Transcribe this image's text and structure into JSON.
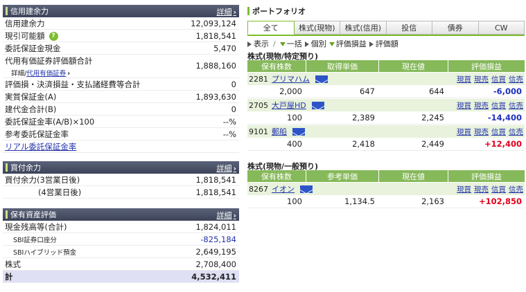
{
  "left": {
    "credit": {
      "title": "信用建余力",
      "detail": "詳細",
      "rows": [
        {
          "label": "信用建余力",
          "value": "12,093,124"
        },
        {
          "label": "現引可能額",
          "value": "1,818,541"
        },
        {
          "label": "委託保証金現金",
          "value": "5,470"
        },
        {
          "label": "代用有価証券評価額合計",
          "sub_label": "詳細/",
          "sub_link": "代用有価証券",
          "value": "1,888,160"
        },
        {
          "label": "評価損・決済損益・支払諸経費等合計",
          "value": "0"
        },
        {
          "label": "実質保証金(A)",
          "value": "1,893,630"
        },
        {
          "label": "建代金合計(B)",
          "value": "0"
        },
        {
          "label": "委託保証金率(A/B)×100",
          "value": "--%"
        },
        {
          "label": "参考委託保証金率",
          "value": "--%"
        },
        {
          "label": "リアル委託保証金率",
          "value": ""
        }
      ]
    },
    "buying": {
      "title": "買付余力",
      "detail": "詳細",
      "rows": [
        {
          "label": "買付余力(3営業日後)",
          "value": "1,818,541"
        },
        {
          "label": "(4営業日後)",
          "value": "1,818,541"
        }
      ]
    },
    "assets": {
      "title": "保有資産評価",
      "detail": "詳細",
      "rows": [
        {
          "label": "現金残高等(合計)",
          "value": "1,824,011"
        },
        {
          "label": "SBI証券口座分",
          "value": "-825,184"
        },
        {
          "label": "SBIハイブリッド預金",
          "value": "2,649,195"
        },
        {
          "label": "株式",
          "value": "2,708,400"
        },
        {
          "label": "計",
          "value": "4,532,411"
        }
      ]
    }
  },
  "portfolio": {
    "title": "ポートフォリオ",
    "tabs": [
      "全て",
      "株式(現物)",
      "株式(信用)",
      "投信",
      "債券",
      "CW"
    ],
    "viewbar": {
      "display": "表示",
      "sep": "/",
      "opt1": "一括",
      "opt2": "個別",
      "opt3": "評価損益",
      "opt4": "評価額"
    },
    "sections": [
      {
        "title": "株式(現物/特定預り)",
        "headers": [
          "保有株数",
          "取得単価",
          "現在値",
          "評価損益"
        ],
        "rows": [
          {
            "code": "2281",
            "name": "プリマハム",
            "qty": "2,000",
            "cost": "647",
            "price": "644",
            "pl": "-6,000"
          },
          {
            "code": "2705",
            "name": "大戸屋HD",
            "qty": "100",
            "cost": "2,389",
            "price": "2,245",
            "pl": "-14,400"
          },
          {
            "code": "9101",
            "name": "郵船",
            "qty": "400",
            "cost": "2,418",
            "price": "2,449",
            "pl": "+12,400"
          }
        ]
      },
      {
        "title": "株式(現物/一般預り)",
        "headers": [
          "保有株数",
          "参考単価",
          "現在値",
          "評価損益"
        ],
        "rows": [
          {
            "code": "8267",
            "name": "イオン",
            "qty": "100",
            "cost": "1,134.5",
            "price": "2,163",
            "pl": "+102,850"
          }
        ]
      }
    ],
    "actions": [
      "現買",
      "現売",
      "信買",
      "信売"
    ]
  }
}
